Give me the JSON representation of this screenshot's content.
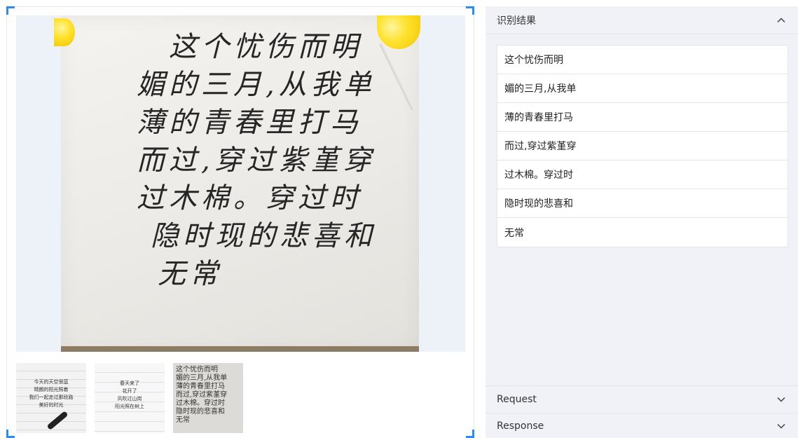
{
  "preview": {
    "main_image": {
      "alt": "handwritten-chinese-note",
      "handwriting_lines": [
        "这个忧伤而明",
        "媚的三月,从我单",
        "薄的青春里打马",
        "而过,穿过紫堇穿",
        "过木棉。穿过时",
        "隐时现的悲喜和",
        "无常"
      ]
    },
    "thumbnails": [
      {
        "lines": [
          "今天的天空很蓝",
          "晴朗的阳光照着",
          "我们一起走过那段路",
          "美好的时光"
        ]
      },
      {
        "lines": [
          "春天来了",
          "花开了",
          "风吹过山岗",
          "阳光照在树上"
        ]
      },
      {
        "lines": [
          "这个忧伤而明",
          "媚的三月,从我单",
          "薄的青春里打马",
          "而过,穿过紫堇穿",
          "过木棉。穿过时",
          "隐时现的悲喜和",
          "无常"
        ]
      }
    ]
  },
  "results": {
    "header_label": "识别结果",
    "items": [
      "这个忧伤而明",
      "媚的三月,从我单",
      "薄的青春里打马",
      "而过,穿过紫堇穿",
      "过木棉。穿过时",
      "隐时现的悲喜和",
      "无常"
    ]
  },
  "request": {
    "header_label": "Request"
  },
  "response": {
    "header_label": "Response"
  },
  "colors": {
    "accent": "#2d8cf0",
    "panel_bg": "#f0f2f7",
    "image_bg": "#edf1f8",
    "pin_yellow": "#ffe330"
  },
  "icons": {
    "result_toggle": "chevron-up-icon",
    "request_toggle": "chevron-down-icon",
    "response_toggle": "chevron-down-icon"
  }
}
